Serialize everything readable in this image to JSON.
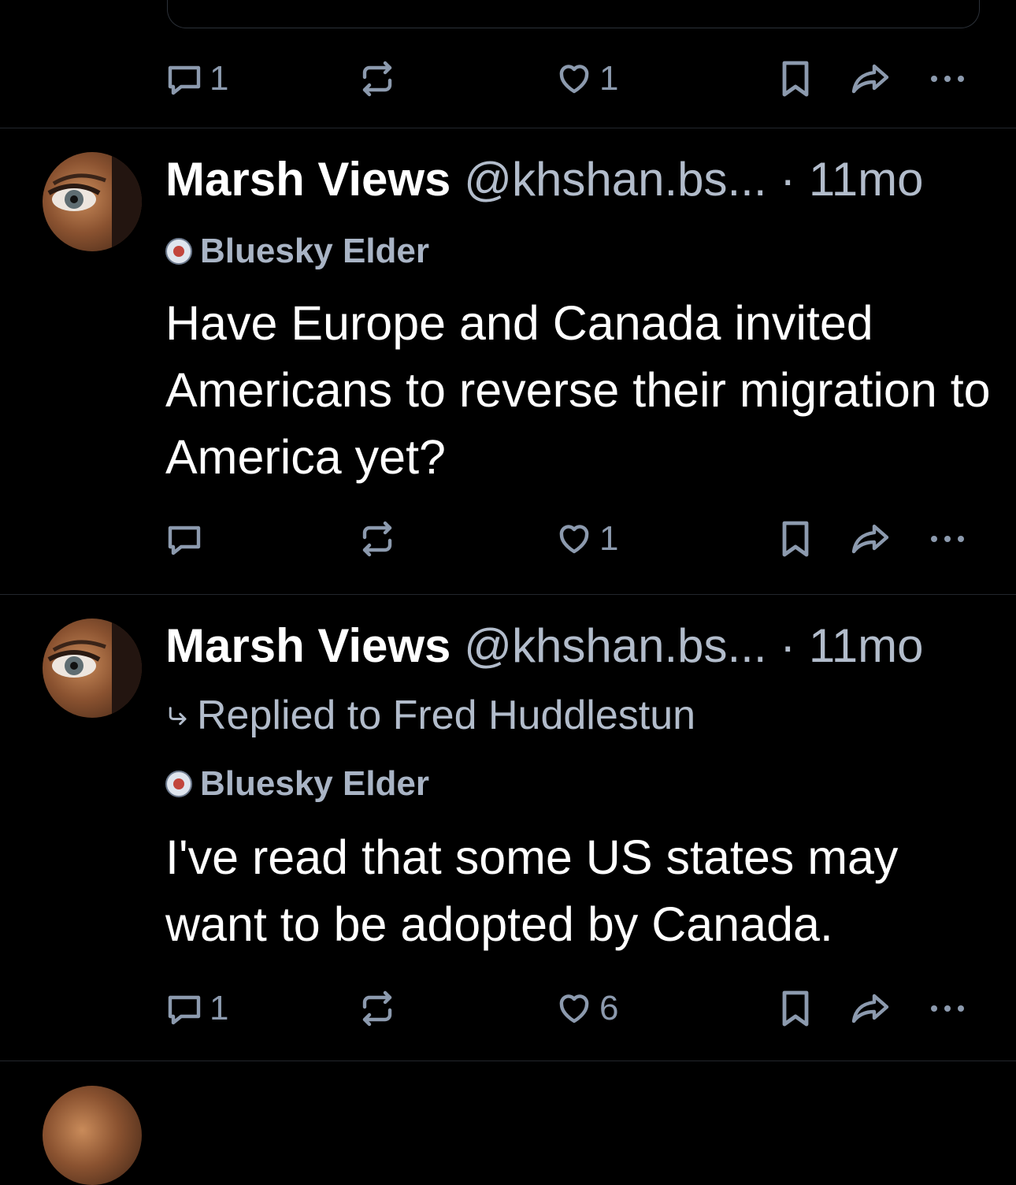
{
  "top_post": {
    "reply_count": "1",
    "like_count": "1"
  },
  "posts": [
    {
      "author_name": "Marsh Views",
      "author_handle": "@khshan.bs...",
      "separator": "·",
      "timestamp": "11mo",
      "badge_label": "Bluesky Elder",
      "text": "Have Europe and Canada  invited Americans to reverse their migration to America yet?",
      "reply_count": "",
      "like_count": "1"
    },
    {
      "author_name": "Marsh Views",
      "author_handle": "@khshan.bs...",
      "separator": "·",
      "timestamp": "11mo",
      "reply_context": "Replied to Fred Huddlestun",
      "badge_label": "Bluesky Elder",
      "text": "I've read that some US states may want to be adopted by Canada.",
      "reply_count": "1",
      "like_count": "6"
    }
  ],
  "icons": [
    "reply-icon",
    "repost-icon",
    "like-icon",
    "bookmark-icon",
    "share-icon",
    "more-icon",
    "reply-arrow-icon"
  ],
  "colors": {
    "background": "#000000",
    "muted": "#8c9aae",
    "text": "#ffffff"
  }
}
